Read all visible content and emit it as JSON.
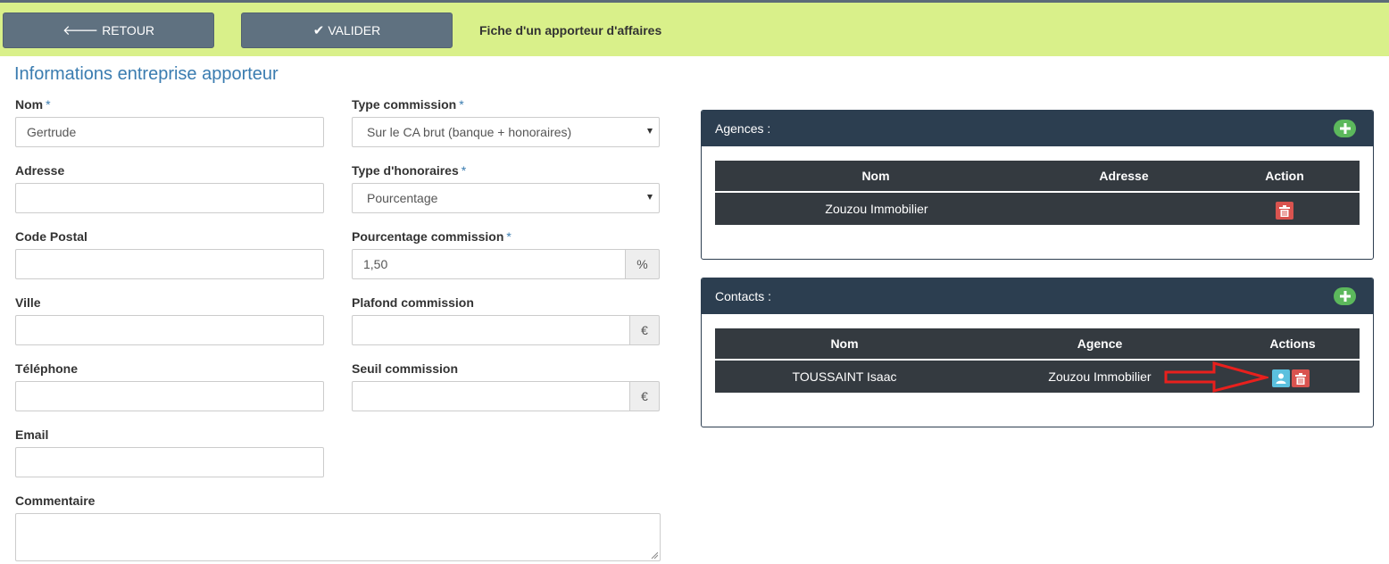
{
  "toolbar": {
    "back_label": "RETOUR",
    "validate_label": "VALIDER",
    "page_title": "Fiche d'un apporteur d'affaires",
    "back_icon": "arrow-left-icon",
    "validate_icon": "check-icon"
  },
  "section_title": "Informations entreprise apporteur",
  "form": {
    "nom": {
      "label": "Nom",
      "required": "*",
      "value": "Gertrude"
    },
    "adresse": {
      "label": "Adresse",
      "value": ""
    },
    "code_postal": {
      "label": "Code Postal",
      "value": ""
    },
    "ville": {
      "label": "Ville",
      "value": ""
    },
    "telephone": {
      "label": "Téléphone",
      "value": ""
    },
    "email": {
      "label": "Email",
      "value": ""
    },
    "commentaire": {
      "label": "Commentaire",
      "value": ""
    },
    "type_commission": {
      "label": "Type commission",
      "required": "*",
      "value": "Sur le CA brut (banque + honoraires)"
    },
    "type_honoraires": {
      "label": "Type d'honoraires",
      "required": "*",
      "value": "Pourcentage"
    },
    "pourcentage_commission": {
      "label": "Pourcentage commission",
      "required": "*",
      "value": "1,50",
      "addon": "%"
    },
    "plafond_commission": {
      "label": "Plafond commission",
      "value": "",
      "addon": "€"
    },
    "seuil_commission": {
      "label": "Seuil commission",
      "value": "",
      "addon": "€"
    }
  },
  "agences": {
    "title": "Agences :",
    "columns": [
      "Nom",
      "Adresse",
      "Action"
    ],
    "rows": [
      {
        "nom": "Zouzou Immobilier",
        "adresse": ""
      }
    ]
  },
  "contacts": {
    "title": "Contacts :",
    "columns": [
      "Nom",
      "Agence",
      "Actions"
    ],
    "rows": [
      {
        "nom": "TOUSSAINT Isaac",
        "agence": "Zouzou Immobilier"
      }
    ]
  },
  "colors": {
    "toolbar_bg": "#d9f08a",
    "button_bg": "#5f7180",
    "accent": "#3a7cb0",
    "panel_header": "#2c3e50",
    "table_bg": "#343a40",
    "add": "#5cb85c",
    "danger": "#d9534f",
    "info": "#5bc0de",
    "arrow": "#e8201d"
  }
}
